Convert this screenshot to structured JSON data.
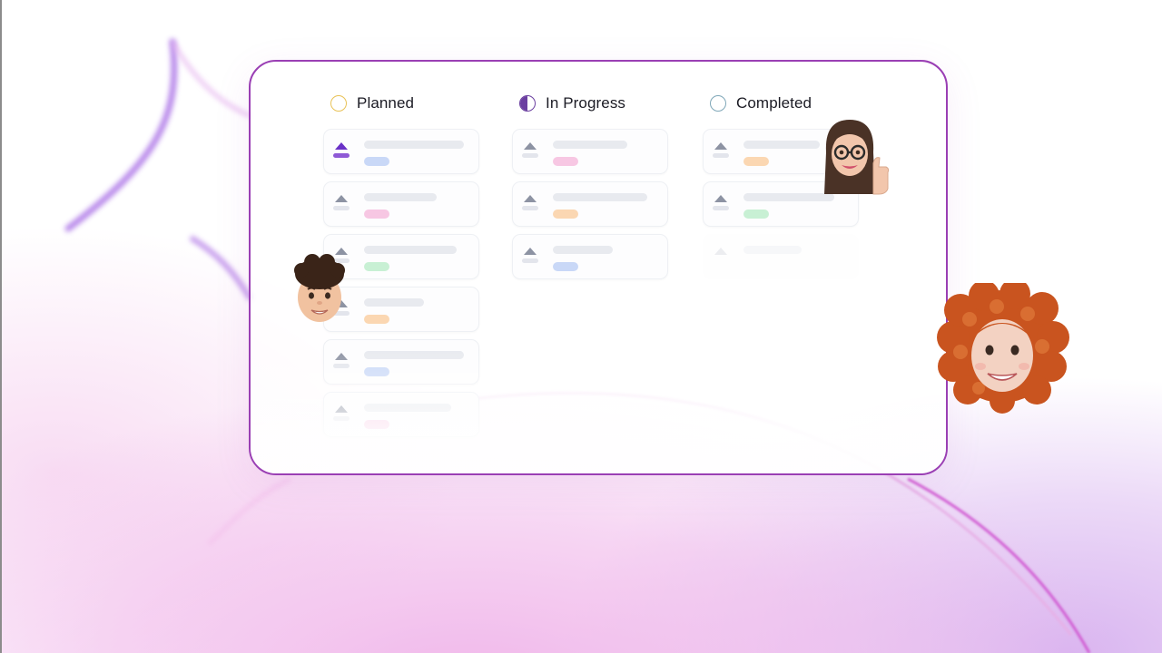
{
  "columns": [
    {
      "title": "Planned",
      "status": "planned"
    },
    {
      "title": "In Progress",
      "status": "in-progress"
    },
    {
      "title": "Completed",
      "status": "completed"
    }
  ],
  "colors": {
    "board_border": "#9a3fb4",
    "planned": "#e8c256",
    "in_progress": "#6b3fa0",
    "completed": "#7fa7b8",
    "tag_blue": "#c9d8f7",
    "tag_pink": "#f7c7e3",
    "tag_green": "#c8f0d4",
    "tag_orange": "#fbd7b2"
  },
  "icons": [
    "status-circle-icon",
    "half-circle-progress-icon",
    "priority-triangle-icon"
  ],
  "avatars": [
    "avatar-curly-haired-man",
    "avatar-woman-glasses-thumbs-up",
    "avatar-curly-red-hair"
  ]
}
